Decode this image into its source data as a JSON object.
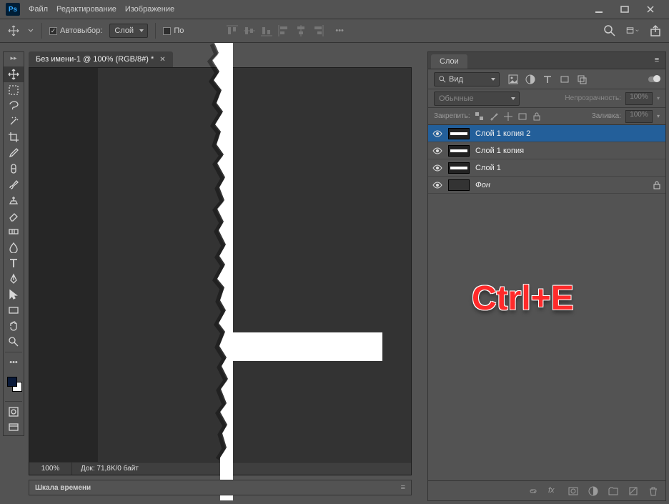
{
  "app": {
    "logo": "Ps"
  },
  "menu": {
    "file": "Файл",
    "edit": "Редактирование",
    "image": "Изображение"
  },
  "options": {
    "autoselect_label": "Автовыбор:",
    "autoselect_value": "Слой",
    "po_fragment": "По"
  },
  "document": {
    "tab_title": "Без имени-1 @ 100% (RGB/8#) *",
    "zoom": "100%",
    "doc_info": "Док: 71,8K/0 байт"
  },
  "timeline": {
    "title": "Шкала времени"
  },
  "layers_panel": {
    "tab": "Слои",
    "filter_value": "Вид",
    "blend_mode": "Обычные",
    "opacity_label": "Непрозрачность:",
    "opacity_value": "100%",
    "lock_label": "Закрепить:",
    "fill_label": "Заливка:",
    "fill_value": "100%",
    "layers": [
      {
        "name": "Слой 1 копия 2",
        "type": "line"
      },
      {
        "name": "Слой 1 копия",
        "type": "line"
      },
      {
        "name": "Слой 1",
        "type": "line"
      },
      {
        "name": "Фон",
        "type": "bg",
        "locked": true
      }
    ]
  },
  "overlay": {
    "shortcut": "Ctrl+E"
  }
}
